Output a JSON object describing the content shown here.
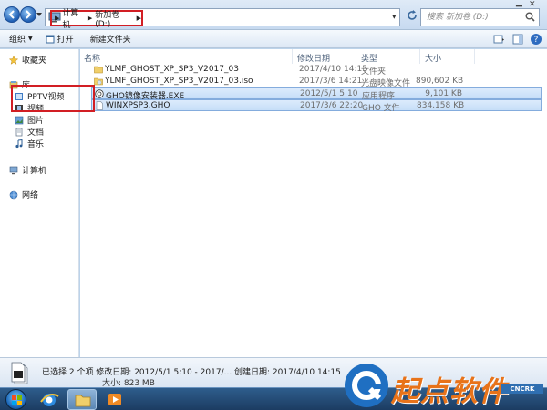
{
  "address": {
    "crumbs": [
      "计算机",
      "新加卷 (D:)"
    ],
    "search_placeholder": "搜索 新加卷 (D:)"
  },
  "toolbar": {
    "organize": "组织",
    "open": "打开",
    "new_folder": "新建文件夹"
  },
  "nav": {
    "favorites": "收藏夹",
    "libraries": "库",
    "pptv": "PPTV视频",
    "videos": "视频",
    "pictures": "图片",
    "documents": "文档",
    "music": "音乐",
    "computer": "计算机",
    "network": "网络"
  },
  "columns": {
    "name": "名称",
    "date": "修改日期",
    "type": "类型",
    "size": "大小"
  },
  "files": [
    {
      "name": "YLMF_GHOST_XP_SP3_V2017_03",
      "date": "2017/4/10 14:15",
      "type": "文件夹",
      "size": "",
      "icon": "folder-icon",
      "selected": false
    },
    {
      "name": "YLMF_GHOST_XP_SP3_V2017_03.iso",
      "date": "2017/3/6 14:21",
      "type": "光盘映像文件",
      "size": "890,602 KB",
      "icon": "disc-image-icon",
      "selected": false
    },
    {
      "name": "GHO镜像安装器.EXE",
      "date": "2012/5/1 5:10",
      "type": "应用程序",
      "size": "9,101 KB",
      "icon": "installer-icon",
      "selected": true
    },
    {
      "name": "WINXPSP3.GHO",
      "date": "2017/3/6 22:20",
      "type": "GHO 文件",
      "size": "834,158 KB",
      "icon": "file-icon",
      "selected": true
    }
  ],
  "details": {
    "line1": "已选择 2 个项  修改日期: 2012/5/1 5:10 - 2017/...  创建日期: 2017/4/10 14:15",
    "line2": "大小: 823 MB"
  },
  "watermark": {
    "text": "起点软件",
    "tag": "CNCRK"
  }
}
